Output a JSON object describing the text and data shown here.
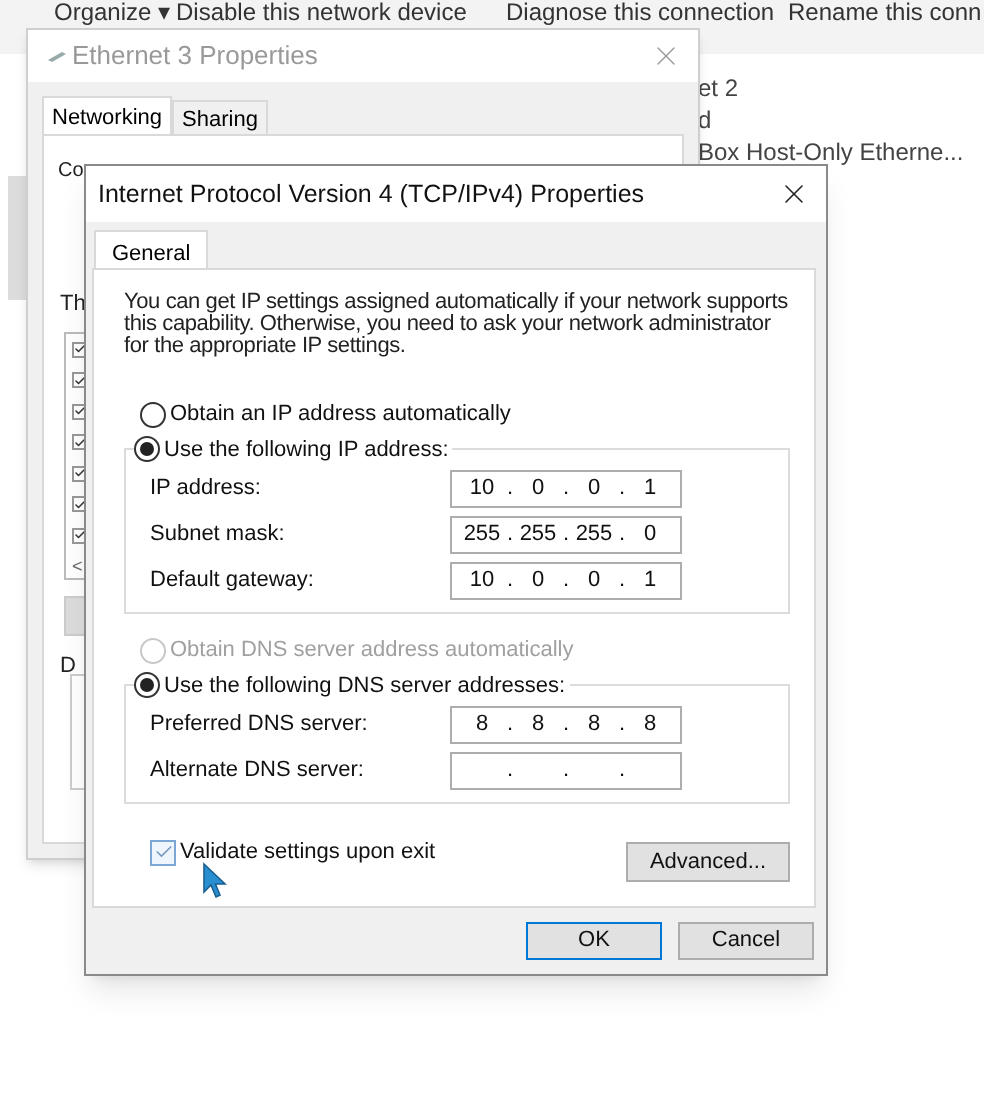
{
  "background": {
    "toolbar": [
      "Organize ▾",
      "Disable this network device",
      "Diagnose this connection",
      "Rename this conn"
    ],
    "connection_texts": [
      "et 2",
      "d",
      "Box Host-Only Etherne..."
    ]
  },
  "ethernet_window": {
    "title": "Ethernet 3 Properties",
    "tabs": [
      {
        "label": "Networking",
        "selected": true
      },
      {
        "label": "Sharing",
        "selected": false
      }
    ],
    "text_1": "Co",
    "text_2": "Th",
    "components": [
      {
        "checked": true
      },
      {
        "checked": true
      },
      {
        "checked": true
      },
      {
        "checked": true
      },
      {
        "checked": true
      },
      {
        "checked": true
      },
      {
        "checked": true
      }
    ],
    "scroll_arrow": "<",
    "text_3": "D"
  },
  "ipv4_window": {
    "title": "Internet Protocol Version 4 (TCP/IPv4) Properties",
    "tabs": [
      {
        "label": "General",
        "selected": true
      }
    ],
    "description": "You can get IP settings assigned automatically if your network supports this capability. Otherwise, you need to ask your network administrator for the appropriate IP settings.",
    "separator": ".",
    "ip_options": [
      {
        "label": "Obtain an IP address automatically",
        "selected": false,
        "disabled": false
      },
      {
        "label": "Use the following IP address:",
        "selected": true,
        "disabled": false
      }
    ],
    "ip_fields": [
      {
        "label": "IP address:",
        "octets": [
          "10",
          "0",
          "0",
          "1"
        ]
      },
      {
        "label": "Subnet mask:",
        "octets": [
          "255",
          "255",
          "255",
          "0"
        ]
      },
      {
        "label": "Default gateway:",
        "octets": [
          "10",
          "0",
          "0",
          "1"
        ]
      }
    ],
    "dns_options": [
      {
        "label": "Obtain DNS server address automatically",
        "selected": false,
        "disabled": true
      },
      {
        "label": "Use the following DNS server addresses:",
        "selected": true,
        "disabled": false
      }
    ],
    "dns_fields": [
      {
        "label": "Preferred DNS server:",
        "octets": [
          "8",
          "8",
          "8",
          "8"
        ]
      },
      {
        "label": "Alternate DNS server:"
      }
    ],
    "validate": {
      "label": "Validate settings upon exit",
      "checked": true
    },
    "advanced_button": "Advanced...",
    "ok_button": "OK",
    "cancel_button": "Cancel"
  }
}
